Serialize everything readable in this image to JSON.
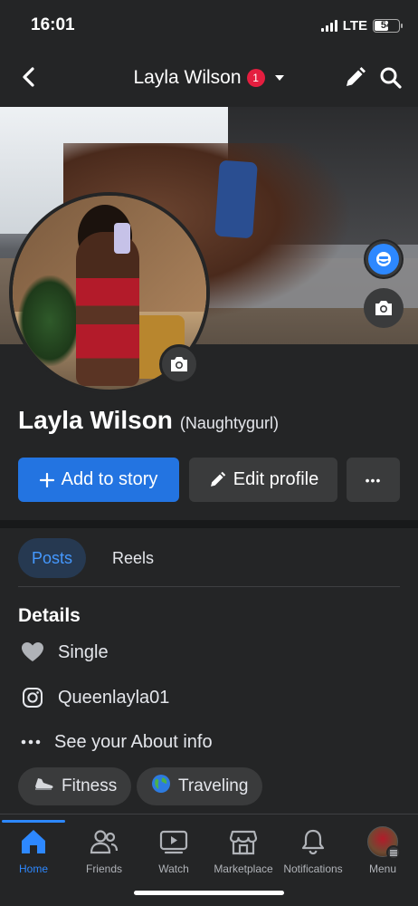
{
  "status_bar": {
    "time": "16:01",
    "network": "LTE",
    "battery": "54"
  },
  "header": {
    "title": "Layla Wilson",
    "badge_count": "1"
  },
  "profile": {
    "name": "Layla Wilson",
    "alternate_name": "(Naughtygurl)"
  },
  "actions": {
    "add_story": "Add to story",
    "edit_profile": "Edit profile",
    "more": "•••"
  },
  "tabs": [
    {
      "label": "Posts",
      "active": true
    },
    {
      "label": "Reels",
      "active": false
    }
  ],
  "details": {
    "heading": "Details",
    "relationship": "Single",
    "instagram": "Queenlayla01",
    "about": "See your About info"
  },
  "hobbies": [
    {
      "label": "Fitness",
      "icon": "running-shoe-icon"
    },
    {
      "label": "Traveling",
      "icon": "globe-icon"
    }
  ],
  "bottom_nav": [
    {
      "label": "Home",
      "icon": "home-icon",
      "active": true
    },
    {
      "label": "Friends",
      "icon": "friends-icon",
      "active": false
    },
    {
      "label": "Watch",
      "icon": "watch-icon",
      "active": false
    },
    {
      "label": "Marketplace",
      "icon": "marketplace-icon",
      "active": false
    },
    {
      "label": "Notifications",
      "icon": "bell-icon",
      "active": false
    },
    {
      "label": "Menu",
      "icon": "menu-avatar-icon",
      "active": false
    }
  ],
  "colors": {
    "accent": "#2374e1",
    "active_tab_bg": "#263951",
    "active_tab_text": "#4599ff",
    "badge": "#e41e3f",
    "background": "#242526"
  }
}
